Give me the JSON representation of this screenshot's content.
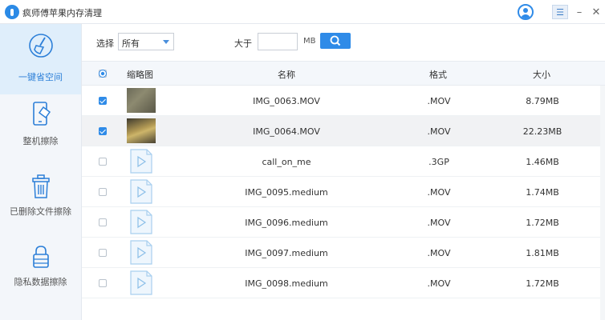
{
  "app": {
    "title": "疯师傅苹果内存清理"
  },
  "window_controls": {
    "menu": "☰",
    "minimize": "–",
    "close": "✕"
  },
  "sidebar": {
    "items": [
      {
        "label": "一键省空间",
        "icon": "broom-icon",
        "active": true
      },
      {
        "label": "整机擦除",
        "icon": "phone-erase-icon",
        "active": false
      },
      {
        "label": "已删除文件擦除",
        "icon": "trash-icon",
        "active": false
      },
      {
        "label": "隐私数据擦除",
        "icon": "lock-icon",
        "active": false
      }
    ]
  },
  "toolbar": {
    "filter_label": "选择",
    "filter_value": "所有",
    "size_label": "大于",
    "size_value": "",
    "unit": "MB"
  },
  "table": {
    "columns": [
      "缩略图",
      "名称",
      "格式",
      "大小"
    ],
    "rows": [
      {
        "checked": true,
        "thumb": "photo1",
        "name": "IMG_0063.MOV",
        "format": ".MOV",
        "size": "8.79MB"
      },
      {
        "checked": true,
        "thumb": "photo2",
        "name": "IMG_0064.MOV",
        "format": ".MOV",
        "size": "22.23MB"
      },
      {
        "checked": false,
        "thumb": "file",
        "name": "call_on_me",
        "format": ".3GP",
        "size": "1.46MB"
      },
      {
        "checked": false,
        "thumb": "file",
        "name": "IMG_0095.medium",
        "format": ".MOV",
        "size": "1.74MB"
      },
      {
        "checked": false,
        "thumb": "file",
        "name": "IMG_0096.medium",
        "format": ".MOV",
        "size": "1.72MB"
      },
      {
        "checked": false,
        "thumb": "file",
        "name": "IMG_0097.medium",
        "format": ".MOV",
        "size": "1.81MB"
      },
      {
        "checked": false,
        "thumb": "file",
        "name": "IMG_0098.medium",
        "format": ".MOV",
        "size": "1.72MB"
      }
    ]
  },
  "colors": {
    "accent": "#2f8be8",
    "sidebar_bg": "#f3f6fa",
    "active_bg": "#dfeefb",
    "row_highlight": "#f1f2f4"
  }
}
